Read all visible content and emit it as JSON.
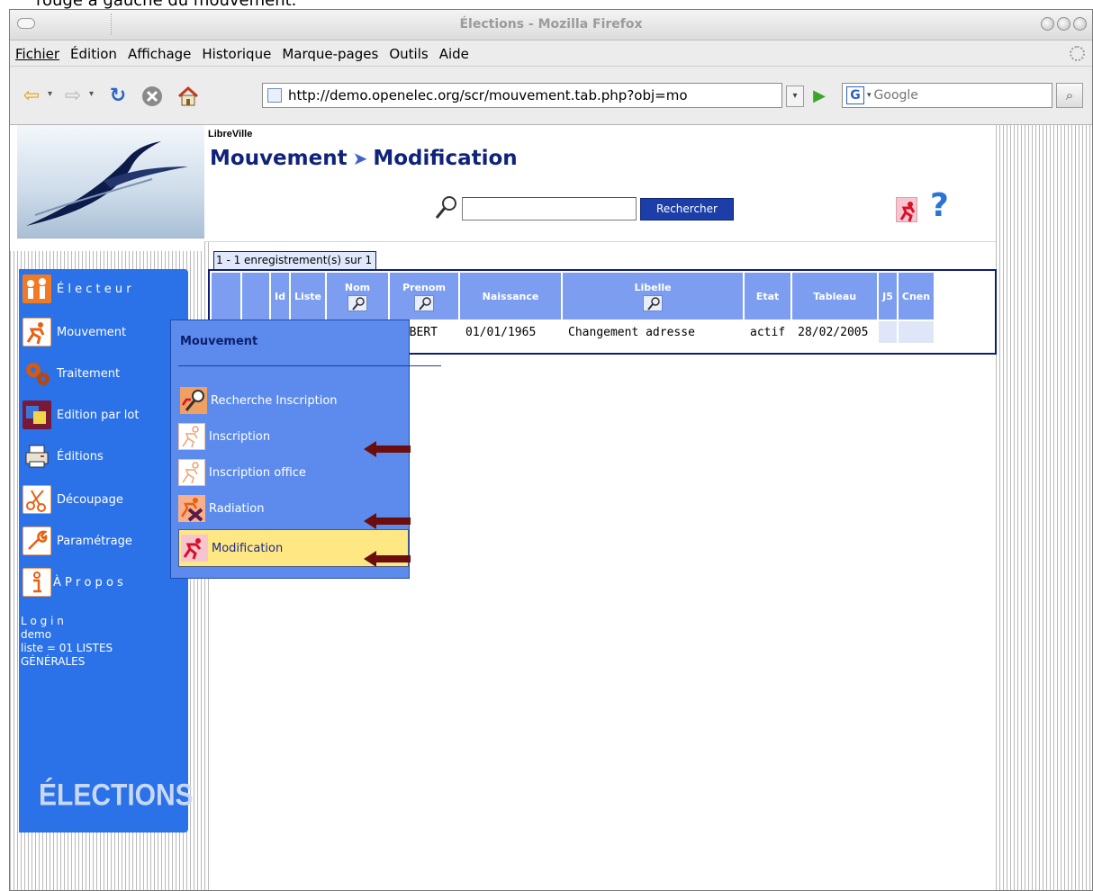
{
  "caption": "rouge à gauche du mouvement.",
  "window": {
    "title": "Élections - Mozilla Firefox"
  },
  "menu": [
    "Fichier",
    "Édition",
    "Affichage",
    "Historique",
    "Marque-pages",
    "Outils",
    "Aide"
  ],
  "toolbar": {
    "url": "http://demo.openelec.org/scr/mouvement.tab.php?obj=mo",
    "search_placeholder": "Google",
    "search_engine_letter": "G"
  },
  "header": {
    "city": "LibreVille",
    "title_part1": "Mouvement",
    "title_part2": "Modification",
    "search_button": "Rechercher",
    "help_symbol": "?"
  },
  "sidebar": {
    "items": [
      {
        "label": "É l e c t e u r",
        "icon": "voter-icon"
      },
      {
        "label": "Mouvement",
        "icon": "runner-icon"
      },
      {
        "label": "Traitement",
        "icon": "gears-icon"
      },
      {
        "label": "Edition par lot",
        "icon": "batch-edit-icon"
      },
      {
        "label": "Éditions",
        "icon": "printer-icon"
      },
      {
        "label": "Découpage",
        "icon": "scissors-icon"
      },
      {
        "label": "Paramétrage",
        "icon": "wrench-icon"
      },
      {
        "label": "À P r o p o s",
        "icon": "info-icon"
      }
    ],
    "login_label": "L o g i n",
    "login_user": "demo",
    "list_line1": "liste = 01 LISTES",
    "list_line2": "GÉNÉRALES",
    "brand": "ÉLECTIONS"
  },
  "records": {
    "count": "1 - 1 enregistrement(s) sur 1",
    "columns": [
      "",
      "",
      "Id",
      "Liste",
      "Nom",
      "Prenom",
      "Naissance",
      "Libelle",
      "Etat",
      "Tableau",
      "J5",
      "Cnen"
    ],
    "searchable_columns": [
      "Nom",
      "Prenom",
      "Libelle"
    ],
    "row": [
      "",
      "",
      "",
      "",
      "",
      "ALBERT",
      "01/01/1965",
      "Changement adresse",
      "actif",
      "28/02/2005",
      "",
      ""
    ]
  },
  "popup": {
    "title": "Mouvement",
    "items": [
      {
        "label": "Recherche Inscription",
        "icon": "search-inscription-icon",
        "arrow": false,
        "selected": false
      },
      {
        "label": "Inscription",
        "icon": "inscription-icon",
        "arrow": true,
        "selected": false
      },
      {
        "label": "Inscription office",
        "icon": "inscription-office-icon",
        "arrow": false,
        "selected": false
      },
      {
        "label": "Radiation",
        "icon": "radiation-icon",
        "arrow": true,
        "selected": false
      },
      {
        "label": "Modification",
        "icon": "modification-icon",
        "arrow": true,
        "selected": true
      }
    ]
  },
  "colors": {
    "sidebar": "#2b71e8",
    "popup": "#5c8bed",
    "header_text": "#10237a",
    "table_header": "#7d9ef0",
    "selected_item": "#ffe884",
    "arrow": "#6b0d0d"
  }
}
